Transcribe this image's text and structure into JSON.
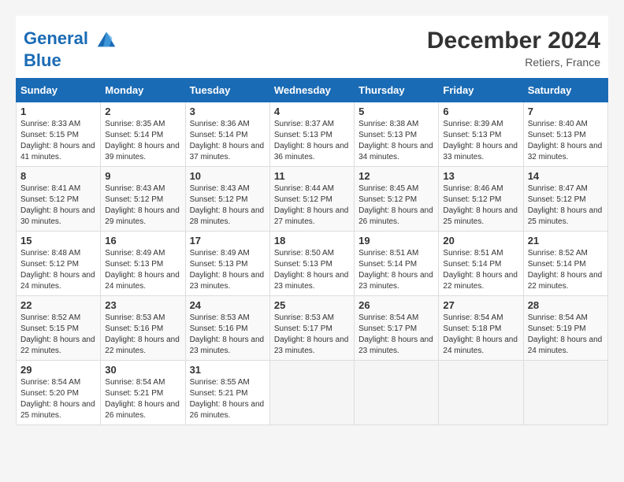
{
  "header": {
    "logo_line1": "General",
    "logo_line2": "Blue",
    "month_year": "December 2024",
    "location": "Retiers, France"
  },
  "weekdays": [
    "Sunday",
    "Monday",
    "Tuesday",
    "Wednesday",
    "Thursday",
    "Friday",
    "Saturday"
  ],
  "weeks": [
    [
      {
        "day": "1",
        "sunrise": "8:33 AM",
        "sunset": "5:15 PM",
        "daylight": "8 hours and 41 minutes."
      },
      {
        "day": "2",
        "sunrise": "8:35 AM",
        "sunset": "5:14 PM",
        "daylight": "8 hours and 39 minutes."
      },
      {
        "day": "3",
        "sunrise": "8:36 AM",
        "sunset": "5:14 PM",
        "daylight": "8 hours and 37 minutes."
      },
      {
        "day": "4",
        "sunrise": "8:37 AM",
        "sunset": "5:13 PM",
        "daylight": "8 hours and 36 minutes."
      },
      {
        "day": "5",
        "sunrise": "8:38 AM",
        "sunset": "5:13 PM",
        "daylight": "8 hours and 34 minutes."
      },
      {
        "day": "6",
        "sunrise": "8:39 AM",
        "sunset": "5:13 PM",
        "daylight": "8 hours and 33 minutes."
      },
      {
        "day": "7",
        "sunrise": "8:40 AM",
        "sunset": "5:13 PM",
        "daylight": "8 hours and 32 minutes."
      }
    ],
    [
      {
        "day": "8",
        "sunrise": "8:41 AM",
        "sunset": "5:12 PM",
        "daylight": "8 hours and 30 minutes."
      },
      {
        "day": "9",
        "sunrise": "8:43 AM",
        "sunset": "5:12 PM",
        "daylight": "8 hours and 29 minutes."
      },
      {
        "day": "10",
        "sunrise": "8:43 AM",
        "sunset": "5:12 PM",
        "daylight": "8 hours and 28 minutes."
      },
      {
        "day": "11",
        "sunrise": "8:44 AM",
        "sunset": "5:12 PM",
        "daylight": "8 hours and 27 minutes."
      },
      {
        "day": "12",
        "sunrise": "8:45 AM",
        "sunset": "5:12 PM",
        "daylight": "8 hours and 26 minutes."
      },
      {
        "day": "13",
        "sunrise": "8:46 AM",
        "sunset": "5:12 PM",
        "daylight": "8 hours and 25 minutes."
      },
      {
        "day": "14",
        "sunrise": "8:47 AM",
        "sunset": "5:12 PM",
        "daylight": "8 hours and 25 minutes."
      }
    ],
    [
      {
        "day": "15",
        "sunrise": "8:48 AM",
        "sunset": "5:12 PM",
        "daylight": "8 hours and 24 minutes."
      },
      {
        "day": "16",
        "sunrise": "8:49 AM",
        "sunset": "5:13 PM",
        "daylight": "8 hours and 24 minutes."
      },
      {
        "day": "17",
        "sunrise": "8:49 AM",
        "sunset": "5:13 PM",
        "daylight": "8 hours and 23 minutes."
      },
      {
        "day": "18",
        "sunrise": "8:50 AM",
        "sunset": "5:13 PM",
        "daylight": "8 hours and 23 minutes."
      },
      {
        "day": "19",
        "sunrise": "8:51 AM",
        "sunset": "5:14 PM",
        "daylight": "8 hours and 23 minutes."
      },
      {
        "day": "20",
        "sunrise": "8:51 AM",
        "sunset": "5:14 PM",
        "daylight": "8 hours and 22 minutes."
      },
      {
        "day": "21",
        "sunrise": "8:52 AM",
        "sunset": "5:14 PM",
        "daylight": "8 hours and 22 minutes."
      }
    ],
    [
      {
        "day": "22",
        "sunrise": "8:52 AM",
        "sunset": "5:15 PM",
        "daylight": "8 hours and 22 minutes."
      },
      {
        "day": "23",
        "sunrise": "8:53 AM",
        "sunset": "5:16 PM",
        "daylight": "8 hours and 22 minutes."
      },
      {
        "day": "24",
        "sunrise": "8:53 AM",
        "sunset": "5:16 PM",
        "daylight": "8 hours and 23 minutes."
      },
      {
        "day": "25",
        "sunrise": "8:53 AM",
        "sunset": "5:17 PM",
        "daylight": "8 hours and 23 minutes."
      },
      {
        "day": "26",
        "sunrise": "8:54 AM",
        "sunset": "5:17 PM",
        "daylight": "8 hours and 23 minutes."
      },
      {
        "day": "27",
        "sunrise": "8:54 AM",
        "sunset": "5:18 PM",
        "daylight": "8 hours and 24 minutes."
      },
      {
        "day": "28",
        "sunrise": "8:54 AM",
        "sunset": "5:19 PM",
        "daylight": "8 hours and 24 minutes."
      }
    ],
    [
      {
        "day": "29",
        "sunrise": "8:54 AM",
        "sunset": "5:20 PM",
        "daylight": "8 hours and 25 minutes."
      },
      {
        "day": "30",
        "sunrise": "8:54 AM",
        "sunset": "5:21 PM",
        "daylight": "8 hours and 26 minutes."
      },
      {
        "day": "31",
        "sunrise": "8:55 AM",
        "sunset": "5:21 PM",
        "daylight": "8 hours and 26 minutes."
      },
      null,
      null,
      null,
      null
    ]
  ]
}
